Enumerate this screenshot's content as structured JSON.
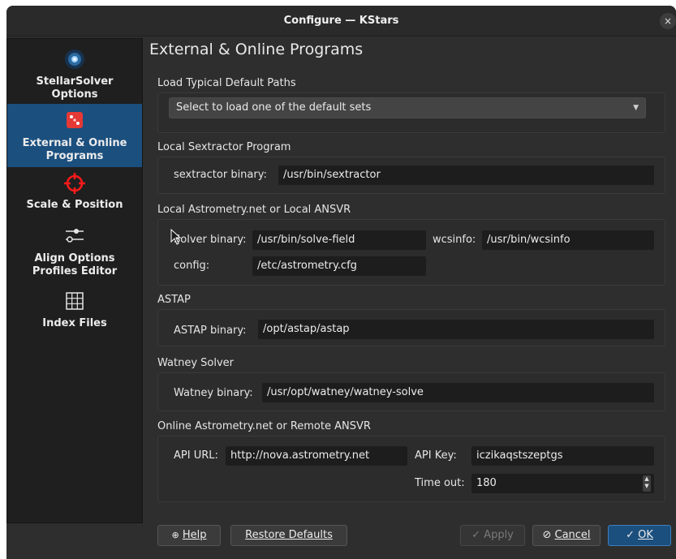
{
  "window": {
    "title": "Configure — KStars",
    "close_glyph": "×"
  },
  "sidebar": {
    "items": [
      {
        "label_line1": "StellarSolver",
        "label_line2": "Options",
        "icon": "galaxy-icon"
      },
      {
        "label_line1": "External & Online",
        "label_line2": "Programs",
        "icon": "dice-icon",
        "active": true
      },
      {
        "label_line1": "Scale & Position",
        "label_line2": "",
        "icon": "crosshair-icon"
      },
      {
        "label_line1": "Align Options",
        "label_line2": "Profiles Editor",
        "icon": "sliders-icon"
      },
      {
        "label_line1": "Index Files",
        "label_line2": "",
        "icon": "grid-icon"
      }
    ]
  },
  "page": {
    "title": "External & Online Programs",
    "groups": {
      "default_paths": {
        "label": "Load Typical Default Paths",
        "combo_value": "Select to load one of the default sets"
      },
      "sextractor": {
        "label": "Local Sextractor Program",
        "binary_label": "sextractor binary:",
        "binary_value": "/usr/bin/sextractor"
      },
      "astrometry": {
        "label": "Local Astrometry.net or Local ANSVR",
        "solver_label": "Solver binary:",
        "solver_value": "/usr/bin/solve-field",
        "wcsinfo_label": "wcsinfo:",
        "wcsinfo_value": "/usr/bin/wcsinfo",
        "config_label": "config:",
        "config_value": "/etc/astrometry.cfg"
      },
      "astap": {
        "label": "ASTAP",
        "binary_label": "ASTAP binary:",
        "binary_value": "/opt/astap/astap"
      },
      "watney": {
        "label": "Watney Solver",
        "binary_label": "Watney binary:",
        "binary_value": "/usr/opt/watney/watney-solve"
      },
      "online": {
        "label": "Online Astrometry.net or Remote ANSVR",
        "api_url_label": "API URL:",
        "api_url_value": "http://nova.astrometry.net",
        "api_key_label": "API Key:",
        "api_key_value": "iczikaqstszeptgs",
        "timeout_label": "Time out:",
        "timeout_value": "180"
      }
    }
  },
  "buttons": {
    "help": "Help",
    "restore_defaults": "Restore Defaults",
    "apply": "Apply",
    "cancel": "Cancel",
    "ok": "OK"
  },
  "colors": {
    "accent": "#1b4f7e",
    "background": "#2e2e2e",
    "field": "#1d1d1d"
  }
}
